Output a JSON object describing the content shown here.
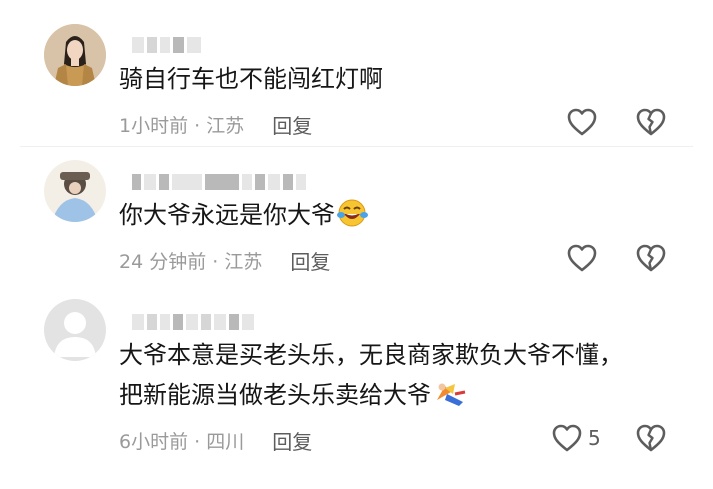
{
  "comments": [
    {
      "text": "骑自行车也不能闯红灯啊",
      "meta": "1小时前 · 江苏",
      "reply_label": "回复",
      "like_count": ""
    },
    {
      "text": "你大爷永远是你大爷",
      "emoji_icon": "crying-laughing-face-icon",
      "meta": "24 分钟前 · 江苏",
      "reply_label": "回复",
      "like_count": ""
    },
    {
      "text_line1": "大爷本意是买老头乐，无良商家欺负大爷不懂，",
      "text_line2": "把新能源当做老头乐卖给大爷",
      "emoji_icon": "dancing-figure-icon",
      "meta": "6小时前 · 四川",
      "reply_label": "回复",
      "like_count": "5"
    }
  ],
  "colors": {
    "text": "#161616",
    "meta": "#9a9a9a",
    "reply": "#5d5d5d",
    "icon": "#5d5d5d"
  }
}
